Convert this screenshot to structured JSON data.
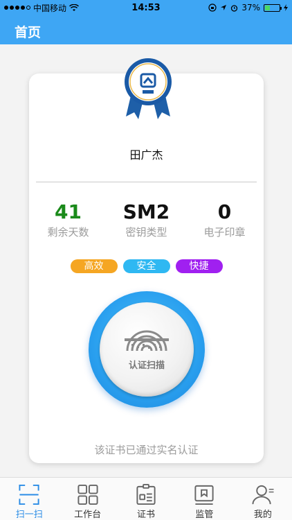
{
  "status_bar": {
    "carrier": "中国移动",
    "time": "14:53",
    "battery": "37%",
    "battery_level": 0.37
  },
  "header": {
    "title": "首页"
  },
  "card": {
    "user_name": "田广杰",
    "stats": [
      {
        "value": "41",
        "label": "剩余天数",
        "color": "#1a8a1a"
      },
      {
        "value": "SM2",
        "label": "密钥类型",
        "color": "#111111"
      },
      {
        "value": "0",
        "label": "电子印章",
        "color": "#111111"
      }
    ],
    "tags": [
      {
        "label": "高效",
        "color": "#f5a623"
      },
      {
        "label": "安全",
        "color": "#2fb8f2"
      },
      {
        "label": "快捷",
        "color": "#a020f0"
      }
    ],
    "scan_button_label": "认证扫描",
    "verified_text": "该证书已通过实名认证"
  },
  "tabs": [
    {
      "label": "扫一扫",
      "icon": "scan-icon",
      "active": true
    },
    {
      "label": "工作台",
      "icon": "grid-icon",
      "active": false
    },
    {
      "label": "证书",
      "icon": "certificate-icon",
      "active": false
    },
    {
      "label": "监管",
      "icon": "monitor-icon",
      "active": false
    },
    {
      "label": "我的",
      "icon": "user-icon",
      "active": false
    }
  ],
  "colors": {
    "header_blue": "#3ea6f4",
    "active_tab": "#2a8ce6"
  }
}
